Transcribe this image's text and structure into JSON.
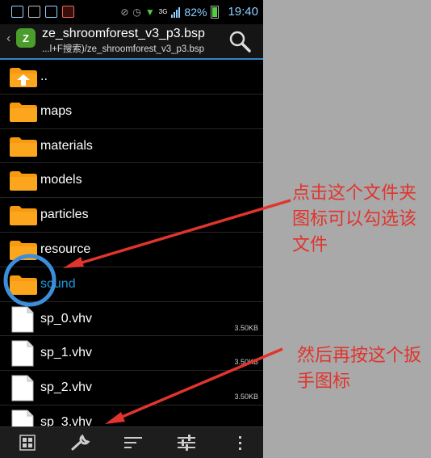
{
  "statusbar": {
    "signal": "3G",
    "battery_pct": "82%",
    "time": "19:40"
  },
  "titlebar": {
    "title": "ze_shroomforest_v3_p3.bsp",
    "path": "...l+F搜索)/ze_shroomforest_v3_p3.bsp",
    "logo_text": "Z"
  },
  "list": [
    {
      "name": "..",
      "type": "up-folder",
      "size": ""
    },
    {
      "name": "maps",
      "type": "folder",
      "size": ""
    },
    {
      "name": "materials",
      "type": "folder",
      "size": ""
    },
    {
      "name": "models",
      "type": "folder",
      "size": ""
    },
    {
      "name": "particles",
      "type": "folder",
      "size": ""
    },
    {
      "name": "resource",
      "type": "folder",
      "size": ""
    },
    {
      "name": "sound",
      "type": "folder",
      "size": "",
      "selected": true
    },
    {
      "name": "sp_0.vhv",
      "type": "file",
      "size": "3.50KB"
    },
    {
      "name": "sp_1.vhv",
      "type": "file",
      "size": "3.50KB"
    },
    {
      "name": "sp_2.vhv",
      "type": "file",
      "size": "3.50KB"
    },
    {
      "name": "sp_3.vhv",
      "type": "file",
      "size": ""
    }
  ],
  "toolbar": [
    "grid-icon",
    "wrench-icon",
    "sort-icon",
    "settings-sliders-icon",
    "more-vert-icon"
  ],
  "annotations": {
    "text1": "点击这个文件夹图标可以勾选该文件",
    "text2": "然后再按这个扳手图标"
  },
  "colors": {
    "accent": "#2d8ac6",
    "folder": "#f79a0f",
    "annotation": "#e0342d",
    "circle": "#3c8edb"
  }
}
